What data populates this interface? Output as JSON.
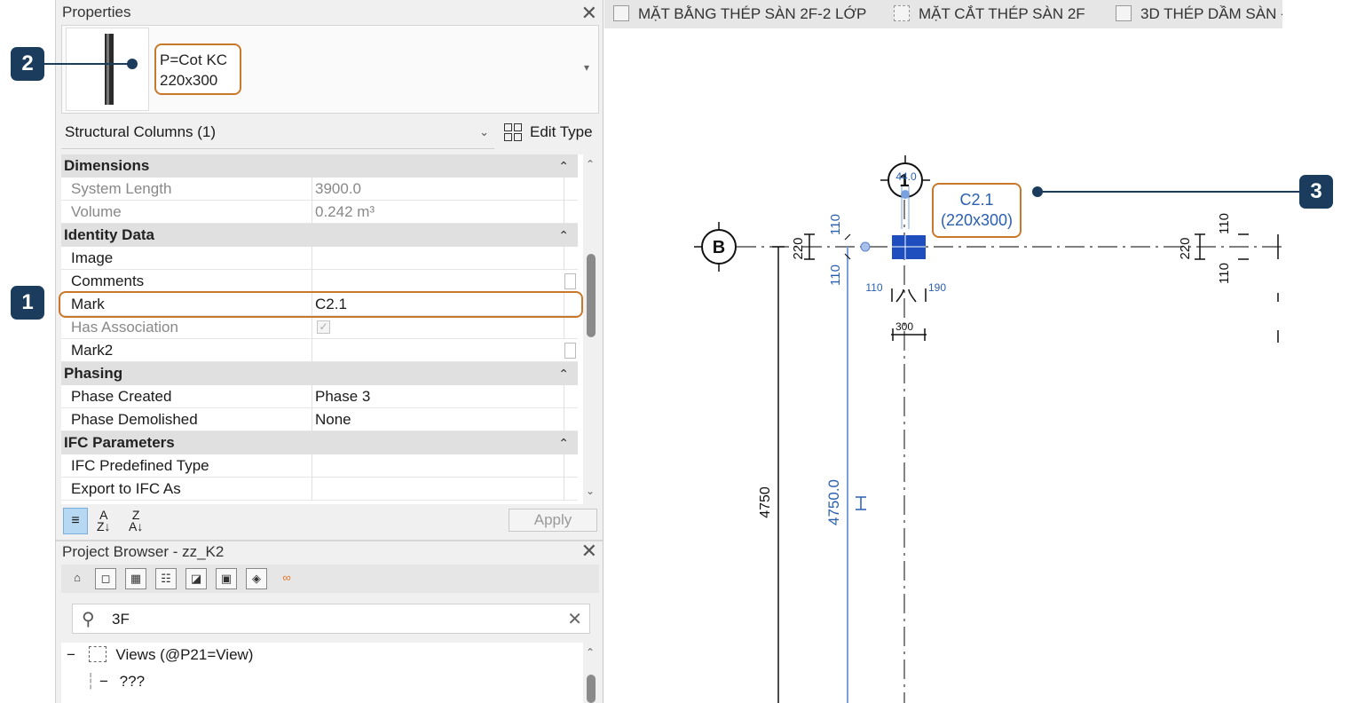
{
  "properties": {
    "title": "Properties",
    "type_name_line1": "P=Cot KC",
    "type_name_line2": "220x300",
    "category": "Structural Columns (1)",
    "edit_type": "Edit Type",
    "groups": {
      "dimensions": "Dimensions",
      "identity": "Identity Data",
      "phasing": "Phasing",
      "ifc": "IFC Parameters"
    },
    "rows": {
      "system_length": {
        "label": "System Length",
        "value": "3900.0"
      },
      "volume": {
        "label": "Volume",
        "value": "0.242 m³"
      },
      "image": {
        "label": "Image",
        "value": ""
      },
      "comments": {
        "label": "Comments",
        "value": ""
      },
      "mark": {
        "label": "Mark",
        "value": "C2.1"
      },
      "has_association": {
        "label": "Has Association",
        "value": "✓"
      },
      "mark2": {
        "label": "Mark2",
        "value": ""
      },
      "phase_created": {
        "label": "Phase Created",
        "value": "Phase 3"
      },
      "phase_demolished": {
        "label": "Phase Demolished",
        "value": "None"
      },
      "ifc_type": {
        "label": "IFC Predefined Type",
        "value": ""
      },
      "export_ifc": {
        "label": "Export to IFC As",
        "value": ""
      }
    },
    "apply": "Apply"
  },
  "browser": {
    "title": "Project Browser - zz_K2",
    "search_value": "3F",
    "tree": {
      "views": "Views (@P21=View)",
      "unknown": "???"
    }
  },
  "tabs": [
    {
      "label": "MẶT BẰNG THÉP SÀN 2F-2 LỚP"
    },
    {
      "label": "MẶT CẮT THÉP SÀN 2F"
    },
    {
      "label": "3D THÉP DẦM SÀN -"
    }
  ],
  "drawing": {
    "grid_b": "B",
    "grid_1": "1",
    "level_tag": "44.0",
    "column_tag_line1": "C2.1",
    "column_tag_line2": "(220x300)",
    "dims": {
      "d220_left": "220",
      "d110_top": "110",
      "d110_bot": "110",
      "d110_small": "110",
      "d190": "190",
      "d300": "300",
      "d220_right": "220",
      "d110_rt": "110",
      "d110_rb": "110",
      "d4750": "4750",
      "d4750_blue": "4750.0"
    }
  },
  "callouts": {
    "one": "1",
    "two": "2",
    "three": "3"
  },
  "colors": {
    "accent": "#c8782a",
    "callout": "#1c3c5e",
    "selection_blue": "#1f4fbf",
    "dim_blue": "#2a5fb0"
  }
}
